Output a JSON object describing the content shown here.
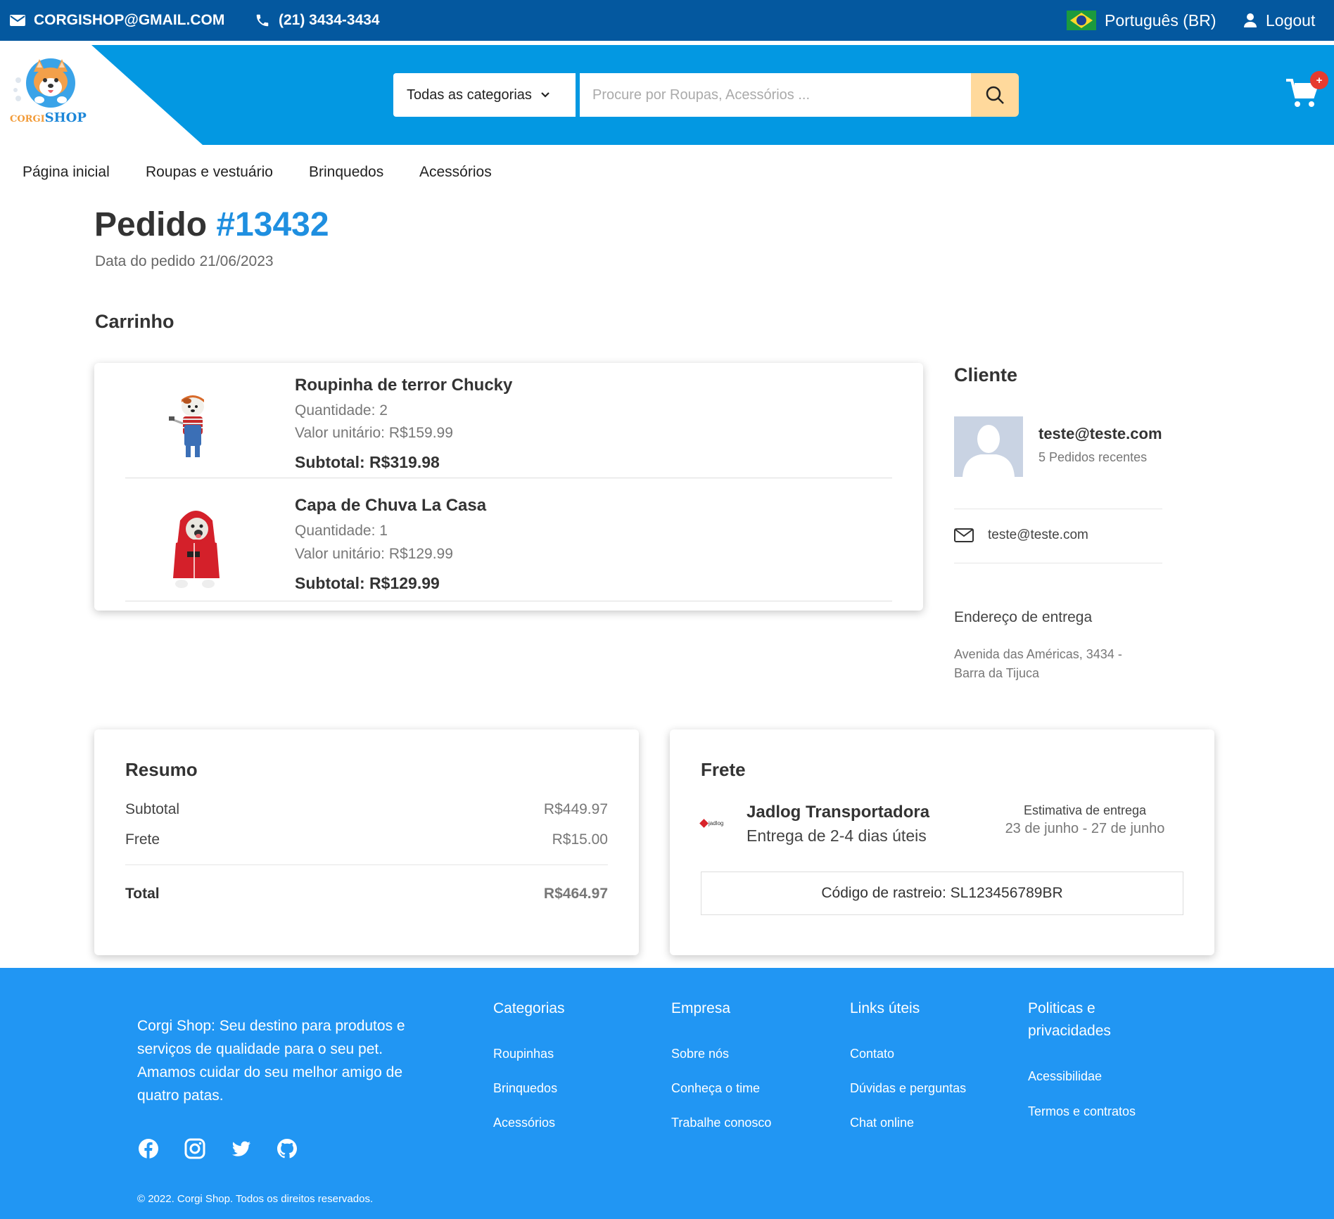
{
  "topbar": {
    "email": "CORGISHOP@GMAIL.COM",
    "phone": "(21) 3434-3434",
    "language": "Português (BR)",
    "logout": "Logout"
  },
  "header": {
    "logo_text_small": "CORGI",
    "logo_text_big": "SHOP",
    "category_select": "Todas as categorias",
    "search_placeholder": "Procure por Roupas, Acessórios ...",
    "cart_badge": "+"
  },
  "nav": [
    "Página inicial",
    "Roupas e vestuário",
    "Brinquedos",
    "Acessórios"
  ],
  "order": {
    "title_prefix": "Pedido",
    "number": "#13432",
    "date_label": "Data do pedido",
    "date": "21/06/2023"
  },
  "cart": {
    "heading": "Carrinho",
    "items": [
      {
        "name": "Roupinha de terror Chucky",
        "qty": "Quantidade: 2",
        "unit": "Valor unitário: R$159.99",
        "subtotal": "Subtotal: R$319.98"
      },
      {
        "name": "Capa de Chuva La Casa",
        "qty": "Quantidade: 1",
        "unit": "Valor unitário: R$129.99",
        "subtotal": "Subtotal: R$129.99"
      }
    ]
  },
  "client": {
    "heading": "Cliente",
    "email": "teste@teste.com",
    "recent_orders": "5 Pedidos recentes",
    "contact_email": "teste@teste.com",
    "address_heading": "Endereço de entrega",
    "address_line1": "Avenida das Américas, 3434 -",
    "address_line2": "Barra da Tijuca"
  },
  "summary": {
    "heading": "Resumo",
    "subtotal_label": "Subtotal",
    "subtotal": "R$449.97",
    "shipping_label": "Frete",
    "shipping": "R$15.00",
    "total_label": "Total",
    "total": "R$464.97"
  },
  "shipping": {
    "heading": "Frete",
    "logo_text": "jadlog",
    "carrier": "Jadlog Transportadora",
    "delivery": "Entrega de 2-4 dias úteis",
    "estimate_label": "Estimativa de entrega",
    "estimate": "23 de junho - 27 de junho",
    "tracking": "Código de rastreio: SL123456789BR"
  },
  "footer": {
    "about": "Corgi Shop: Seu destino para produtos e serviços de qualidade para o seu pet. Amamos cuidar do seu melhor amigo de quatro patas.",
    "columns": [
      {
        "title": "Categorias",
        "links": [
          "Roupinhas",
          "Brinquedos",
          "Acessórios"
        ]
      },
      {
        "title": "Empresa",
        "links": [
          "Sobre nós",
          "Conheça o time",
          "Trabalhe conosco"
        ]
      },
      {
        "title": "Links úteis",
        "links": [
          "Contato",
          "Dúvidas e perguntas",
          "Chat online"
        ]
      },
      {
        "title": "Politicas e privacidades",
        "links": [
          "Acessibilidae",
          "Termos e contratos"
        ]
      }
    ],
    "social": [
      "facebook-icon",
      "instagram-icon",
      "twitter-icon",
      "github-icon"
    ],
    "copyright": "© 2022. Corgi Shop. Todos os direitos reservados."
  },
  "colors": {
    "topbar": "#04589f",
    "header": "#0398e2",
    "accent": "#1f8fe0",
    "search_button": "#ffd99c",
    "footer": "#2196f3",
    "badge": "#e63b2e"
  }
}
